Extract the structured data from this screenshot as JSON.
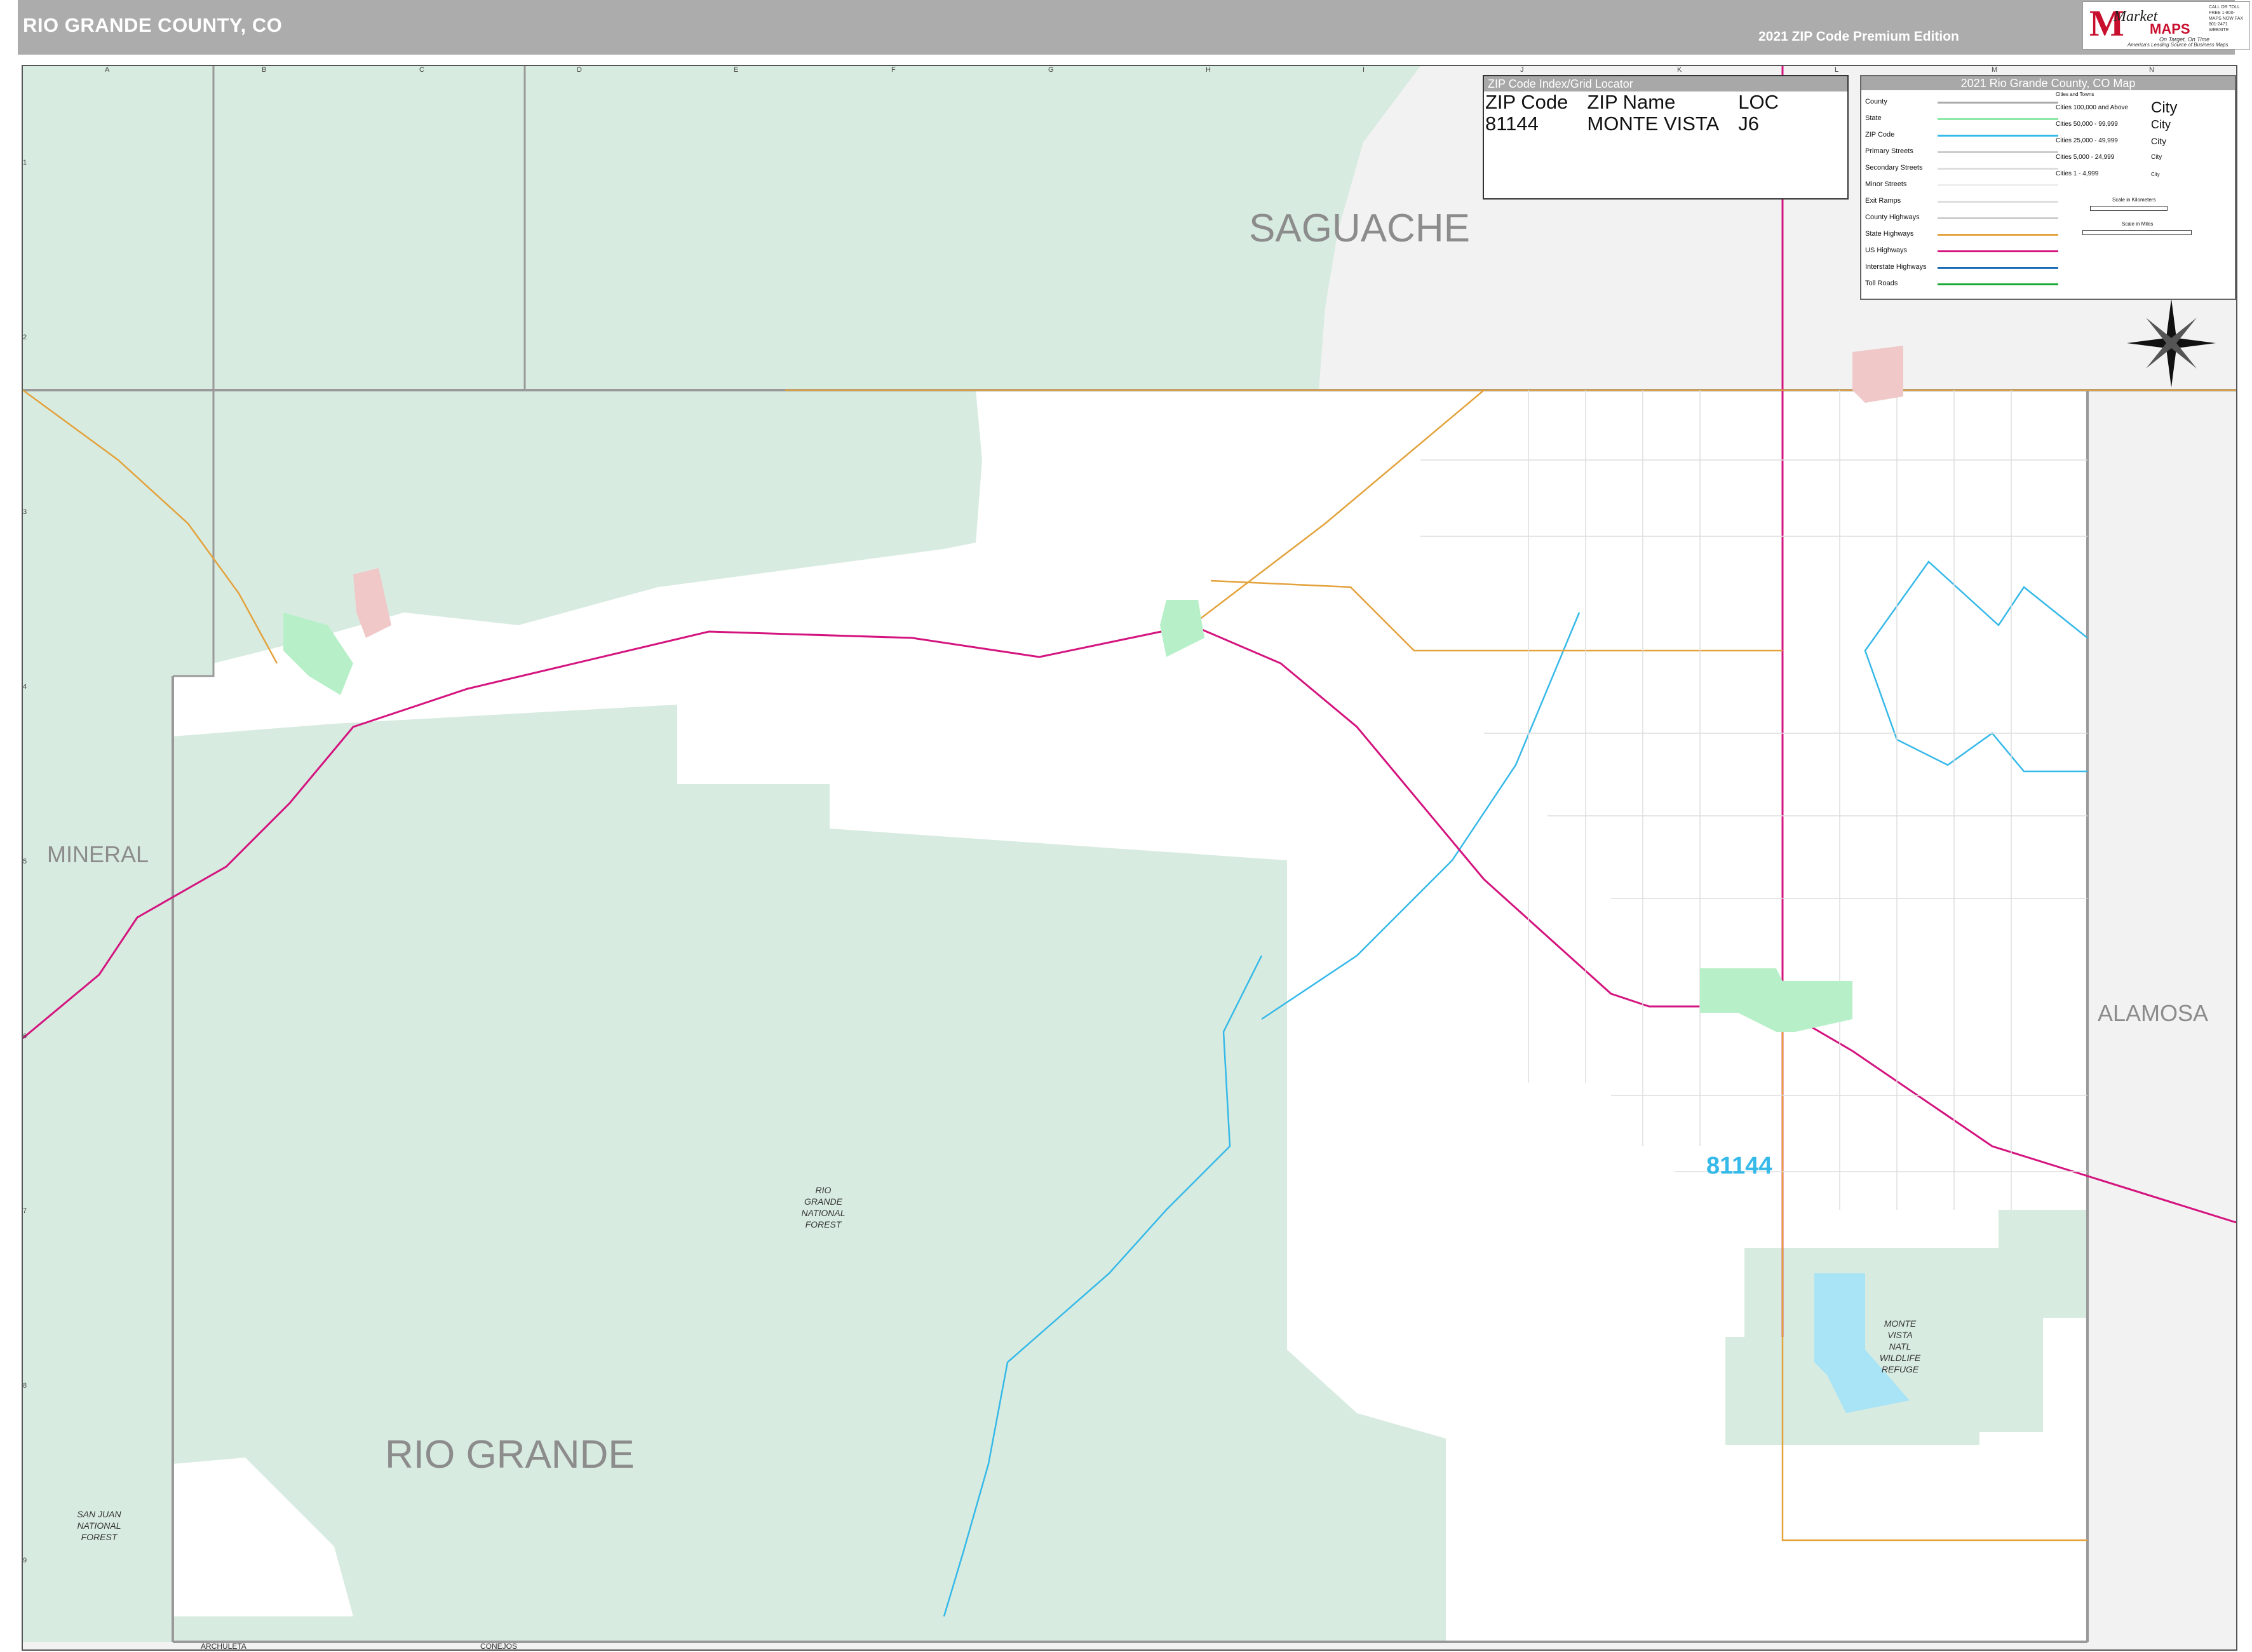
{
  "header": {
    "title": "RIO GRANDE COUNTY, CO",
    "edition": "2021 ZIP Code Premium Edition",
    "logo": {
      "brand": "Market",
      "brand2": "MAPS",
      "tagline1": "On Target, On Time",
      "tagline2": "America's Leading Source of Business Maps",
      "contact": "CALL OR TOLL FREE 1-800-MAPS NOW FAX 801-2471 WEBSITE"
    }
  },
  "map": {
    "grid_letters": [
      "A",
      "B",
      "C",
      "D",
      "E",
      "F",
      "G",
      "H",
      "I",
      "J",
      "K",
      "L",
      "M",
      "N"
    ],
    "grid_numbers": [
      "1",
      "2",
      "3",
      "4",
      "5",
      "6",
      "7",
      "8",
      "9"
    ],
    "counties": {
      "saguache": "SAGUACHE",
      "mineral": "MINERAL",
      "rio_grande": "RIO GRANDE",
      "alamosa": "ALAMOSA",
      "archuleta": "ARCHULETA",
      "conejos": "CONEJOS"
    },
    "forests": {
      "rio_grande_nf": "RIO\nGRANDE\nNATIONAL\nFOREST",
      "san_juan_nf": "SAN JUAN\nNATIONAL\nFOREST",
      "monte_vista_nwr": "MONTE\nVISTA\nNATL\nWILDLIFE\nREFUGE"
    },
    "zip_label": "81144",
    "colors": {
      "forest": "#d8ebe1",
      "outside": "#f2f2f2",
      "county_land": "#ffffff",
      "zip_line": "#35b9e8",
      "us_highway": "#d4157f",
      "state_highway": "#e3a23b",
      "urban": "#b7f0c8"
    }
  },
  "zip_index": {
    "header": "ZIP Code Index/Grid Locator",
    "columns": [
      "ZIP Code",
      "ZIP Name",
      "LOC"
    ],
    "rows": [
      [
        "81144",
        "MONTE VISTA",
        "J6"
      ]
    ]
  },
  "legend": {
    "header": "2021 Rio Grande County, CO Map",
    "items": [
      "County",
      "State",
      "ZIP Code",
      "Primary Streets",
      "Secondary Streets",
      "Minor Streets",
      "Exit Ramps",
      "County Highways",
      "State Highways",
      "US Highways",
      "Interstate Highways",
      "Toll Roads"
    ],
    "cities_header": "Cities and Towns",
    "cities": [
      "Cities 100,000 and Above",
      "Cities 50,000 - 99,999",
      "Cities 25,000 - 49,999",
      "Cities 5,000 - 24,999",
      "Cities 1 - 4,999"
    ],
    "city_samples": [
      "City",
      "City",
      "City",
      "City",
      "City"
    ],
    "scale_km": "Scale in Kilometers",
    "scale_mi": "Scale in Miles"
  },
  "compass": {
    "n": "N",
    "s": "S",
    "e": "E",
    "w": "W"
  }
}
